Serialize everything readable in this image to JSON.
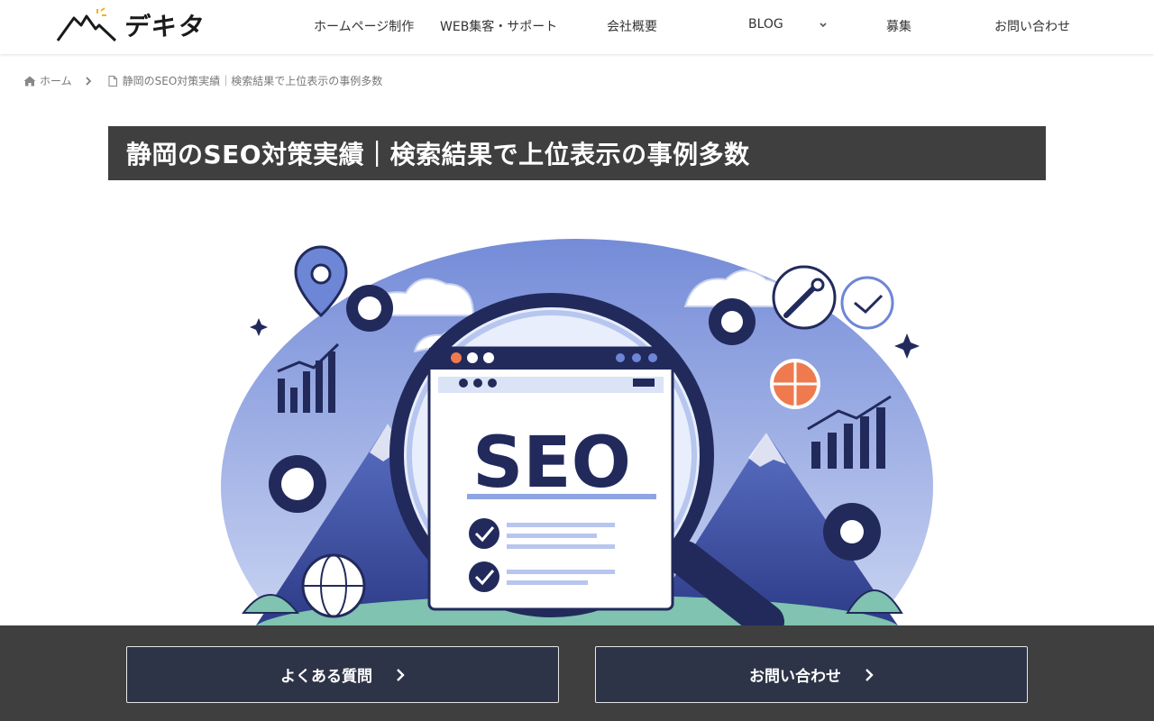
{
  "header": {
    "logo_text": "デキタ",
    "nav": [
      {
        "label": "ホームページ制作"
      },
      {
        "label": "WEB集客・サポート"
      },
      {
        "label": "会社概要"
      },
      {
        "label": "BLOG"
      },
      {
        "label": "募集"
      },
      {
        "label": "お問い合わせ"
      }
    ]
  },
  "breadcrumb": {
    "home": "ホーム",
    "current": "静岡のSEO対策実績｜検索結果で上位表示の事例多数"
  },
  "page": {
    "title": "静岡のSEO対策実績｜検索結果で上位表示の事例多数"
  },
  "hero": {
    "word": "SEO"
  },
  "cta": {
    "faq_label": "よくある質問",
    "contact_label": "お問い合わせ"
  },
  "colors": {
    "title_bg": "#3f3f3f",
    "cta_button_bg": "#2e3447",
    "navy": "#222a5c",
    "accent_orange": "#ef7a4d",
    "sky_blue": "#6d86d6"
  }
}
